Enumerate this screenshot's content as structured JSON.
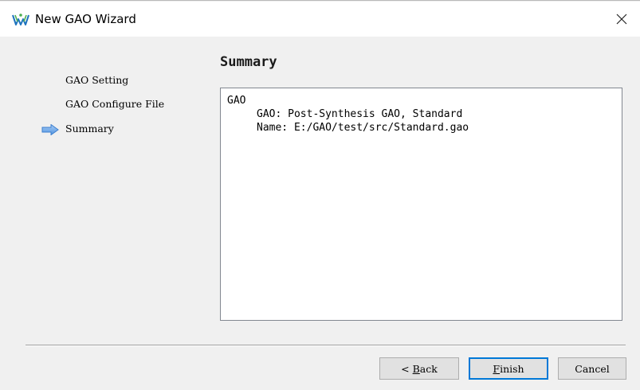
{
  "window": {
    "title": "New GAO Wizard",
    "accent_color": "#0078d7"
  },
  "icons": {
    "app": "gowin-logo-icon",
    "close": "close-icon",
    "current_step": "arrow-right-icon"
  },
  "steps": {
    "items": [
      {
        "label": "GAO Setting",
        "current": false
      },
      {
        "label": "GAO Configure File",
        "current": false
      },
      {
        "label": "Summary",
        "current": true
      }
    ]
  },
  "main": {
    "heading": "Summary",
    "summary_lines": [
      "GAO",
      "GAO: Post-Synthesis GAO, Standard",
      "Name: E:/GAO/test/src/Standard.gao"
    ]
  },
  "buttons": {
    "back": {
      "prefix": "< ",
      "mnemonic": "B",
      "rest": "ack"
    },
    "finish": {
      "prefix": "",
      "mnemonic": "F",
      "rest": "inish"
    },
    "cancel": {
      "label": "Cancel"
    }
  }
}
